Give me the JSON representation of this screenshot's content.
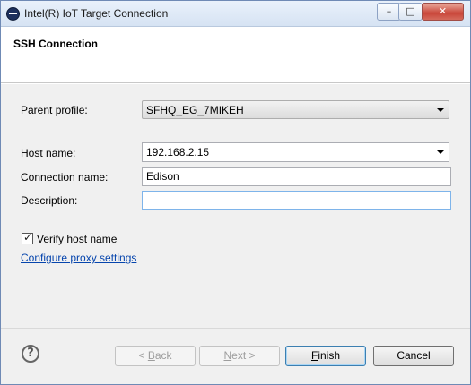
{
  "window": {
    "title": "Intel(R) IoT Target Connection",
    "controls": {
      "minimize": "–",
      "maximize": "□",
      "close": "✕"
    }
  },
  "header": {
    "title": "SSH Connection"
  },
  "form": {
    "parent_profile": {
      "label": "Parent profile:",
      "value": "SFHQ_EG_7MIKEH"
    },
    "host_name": {
      "label": "Host name:",
      "value": "192.168.2.15"
    },
    "connection_name": {
      "label": "Connection name:",
      "value": "Edison"
    },
    "description": {
      "label": "Description:",
      "value": ""
    },
    "verify_host": {
      "label": "Verify host name",
      "checked": true
    },
    "proxy_link": "Configure proxy settings"
  },
  "footer": {
    "help": "?",
    "back": {
      "prefix": "< ",
      "mnemonic": "B",
      "rest": "ack"
    },
    "next": {
      "mnemonic": "N",
      "rest": "ext >"
    },
    "finish": {
      "mnemonic": "F",
      "rest": "inish"
    },
    "cancel": "Cancel"
  }
}
